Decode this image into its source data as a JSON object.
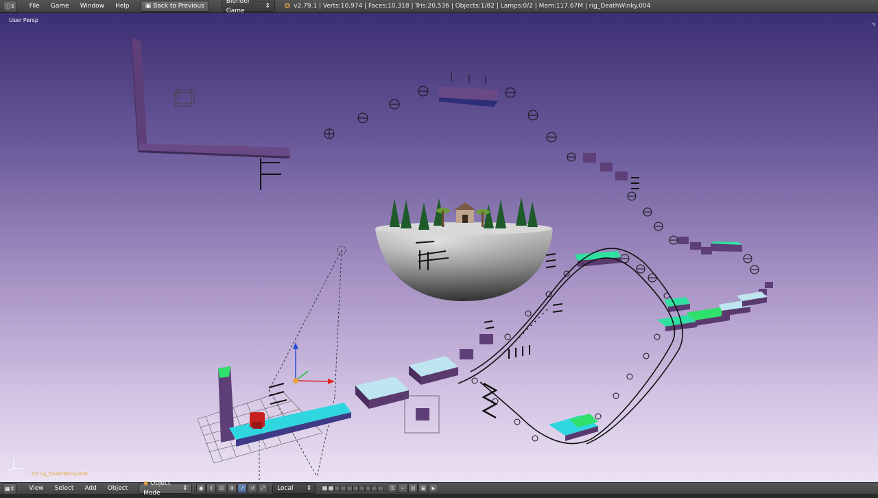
{
  "topbar": {
    "editor_type_icon": "info-icon",
    "menu": [
      "File",
      "Game",
      "Window",
      "Help"
    ],
    "back_button": "Back to Previous",
    "engine": "Blender Game",
    "stats": "v2.79.1 | Verts:10,974 | Faces:10,318 | Tris:20,536 | Objects:1/82 | Lamps:0/2 | Mem:117.67M | rig_DeathWinky.004"
  },
  "viewport": {
    "view_name": "User Persp",
    "object_name": "(0) rig_DeathWinky.004"
  },
  "bottombar": {
    "editor_type_icon": "3d-view-icon",
    "menu": [
      "View",
      "Select",
      "Add",
      "Object"
    ],
    "mode": "Object Mode",
    "orientation": "Local"
  },
  "colors": {
    "platform_top": "#bfe6f0",
    "platform_side": "#5a3a6e",
    "cyan": "#2fd6e0",
    "green": "#2fe06a",
    "wall": "#5e3f78",
    "accent": "#e8a040"
  }
}
